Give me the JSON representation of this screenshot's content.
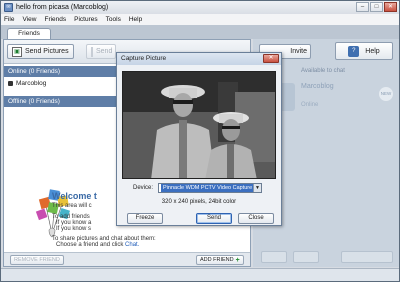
{
  "window": {
    "title": "hello from picasa (Marcoblog)"
  },
  "menu": [
    "File",
    "View",
    "Friends",
    "Pictures",
    "Tools",
    "Help"
  ],
  "tabs": {
    "friends": "Friends"
  },
  "toolbar": {
    "send_pictures": "Send Pictures",
    "send_disabled": "Send"
  },
  "groups": {
    "online": "Online (0 Friends)",
    "offline": "Offline (0 Friends)"
  },
  "contacts": [
    {
      "name": "Marcoblog"
    }
  ],
  "welcome": {
    "title": "Welcome t",
    "line1": "This area will c",
    "line2": "To add friends",
    "line3": "If you know a",
    "line4": "If you know s",
    "line5": "To share pictures and chat about them:",
    "line6_prefix": "Choose a friend and click ",
    "chat_link": "Chat."
  },
  "bottom": {
    "remove_friend": "REMOVE FRIEND",
    "add_friend": "ADD FRIEND"
  },
  "right": {
    "invite": "Invite",
    "help": "Help",
    "status": "Available to chat",
    "name": "Marcoblog",
    "sub": "Online"
  },
  "dialog": {
    "title": "Capture Picture",
    "device_label": "Device:",
    "device_value": "Pinnacle WDM PCTV Video Capture",
    "resolution": "320 x 240 pixels, 24bit color",
    "buttons": {
      "freeze": "Freeze",
      "send": "Send",
      "close": "Close"
    }
  }
}
